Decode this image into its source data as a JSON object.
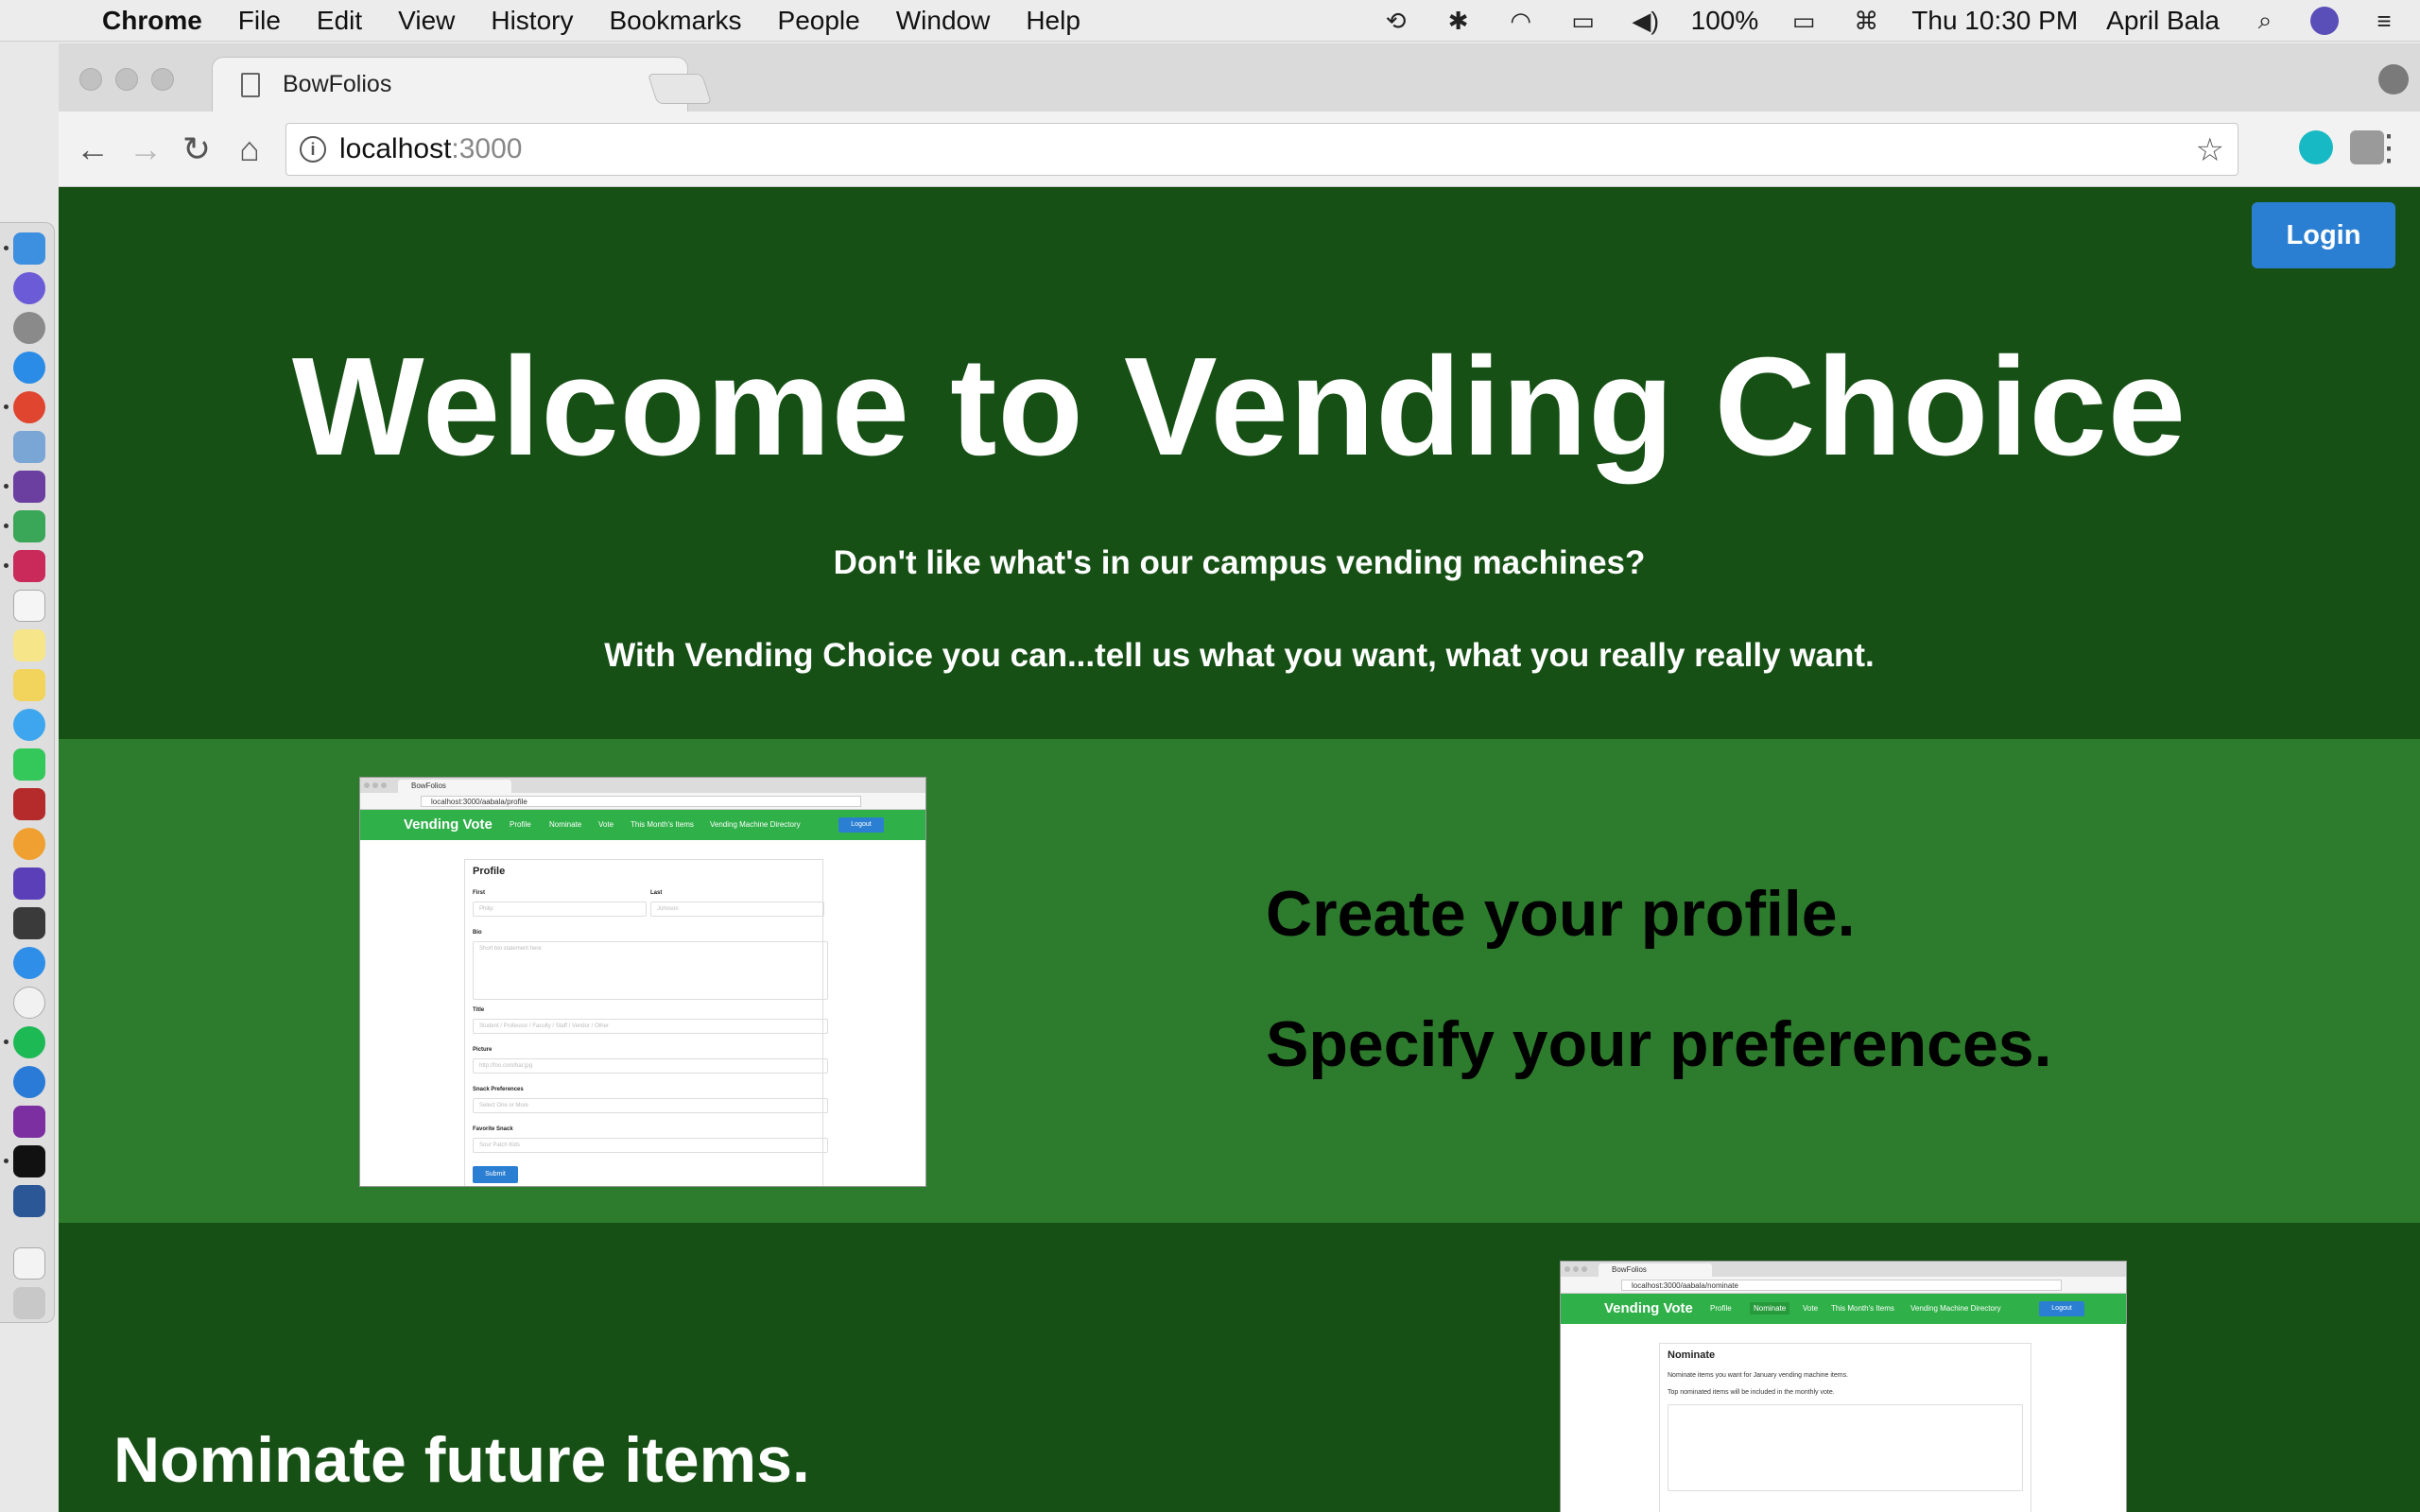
{
  "menubar": {
    "app": "Chrome",
    "items": [
      "File",
      "Edit",
      "View",
      "History",
      "Bookmarks",
      "People",
      "Window",
      "Help"
    ],
    "battery": "100%",
    "clock": "Thu 10:30 PM",
    "user": "April Bala"
  },
  "browser": {
    "tab_title": "BowFolios",
    "tab_close": "×",
    "url_host": "localhost",
    "url_port": ":3000"
  },
  "page": {
    "login_label": "Login",
    "hero_title": "Welcome to Vending Choice",
    "hero_sub1": "Don't like what's in our campus vending machines?",
    "hero_sub2": "With Vending Choice you can...tell us what you want, what you really really want.",
    "feature1_line1": "Create your profile.",
    "feature1_line2": "Specify your preferences.",
    "feature2_line1": "Nominate future items."
  },
  "shot_profile": {
    "tab": "BowFolios",
    "url": "localhost:3000/aabala/profile",
    "brand": "Vending Vote",
    "nav": [
      "Profile",
      "Nominate",
      "Vote",
      "This Month's Items",
      "Vending Machine Directory"
    ],
    "logout": "Logout",
    "heading": "Profile",
    "first_label": "First",
    "first_ph": "Philip",
    "last_label": "Last",
    "last_ph": "Johnson",
    "bio_label": "Bio",
    "bio_ph": "Short bio statement here",
    "title_label": "Title",
    "title_ph": "Student / Professor / Faculty / Staff / Vendor / Other",
    "picture_label": "Picture",
    "picture_ph": "http://foo.com/bar.jpg",
    "snack_label": "Snack Preferences",
    "snack_ph": "Select One or More",
    "fav_label": "Favorite Snack",
    "fav_ph": "Sour Patch Kids",
    "submit": "Submit"
  },
  "shot_nominate": {
    "tab": "BowFolios",
    "url": "localhost:3000/aabala/nominate",
    "brand": "Vending Vote",
    "nav": [
      "Profile",
      "Nominate",
      "Vote",
      "This Month's Items",
      "Vending Machine Directory"
    ],
    "logout": "Logout",
    "heading": "Nominate",
    "line1": "Nominate items you want for January vending machine items.",
    "line2": "Top nominated items will be included in the monthly vote."
  },
  "colors": {
    "hero_bg": "#165015",
    "feature_bg": "#2d7b2d",
    "login_btn": "#2b7fd2",
    "mini_nav": "#2fb048"
  }
}
